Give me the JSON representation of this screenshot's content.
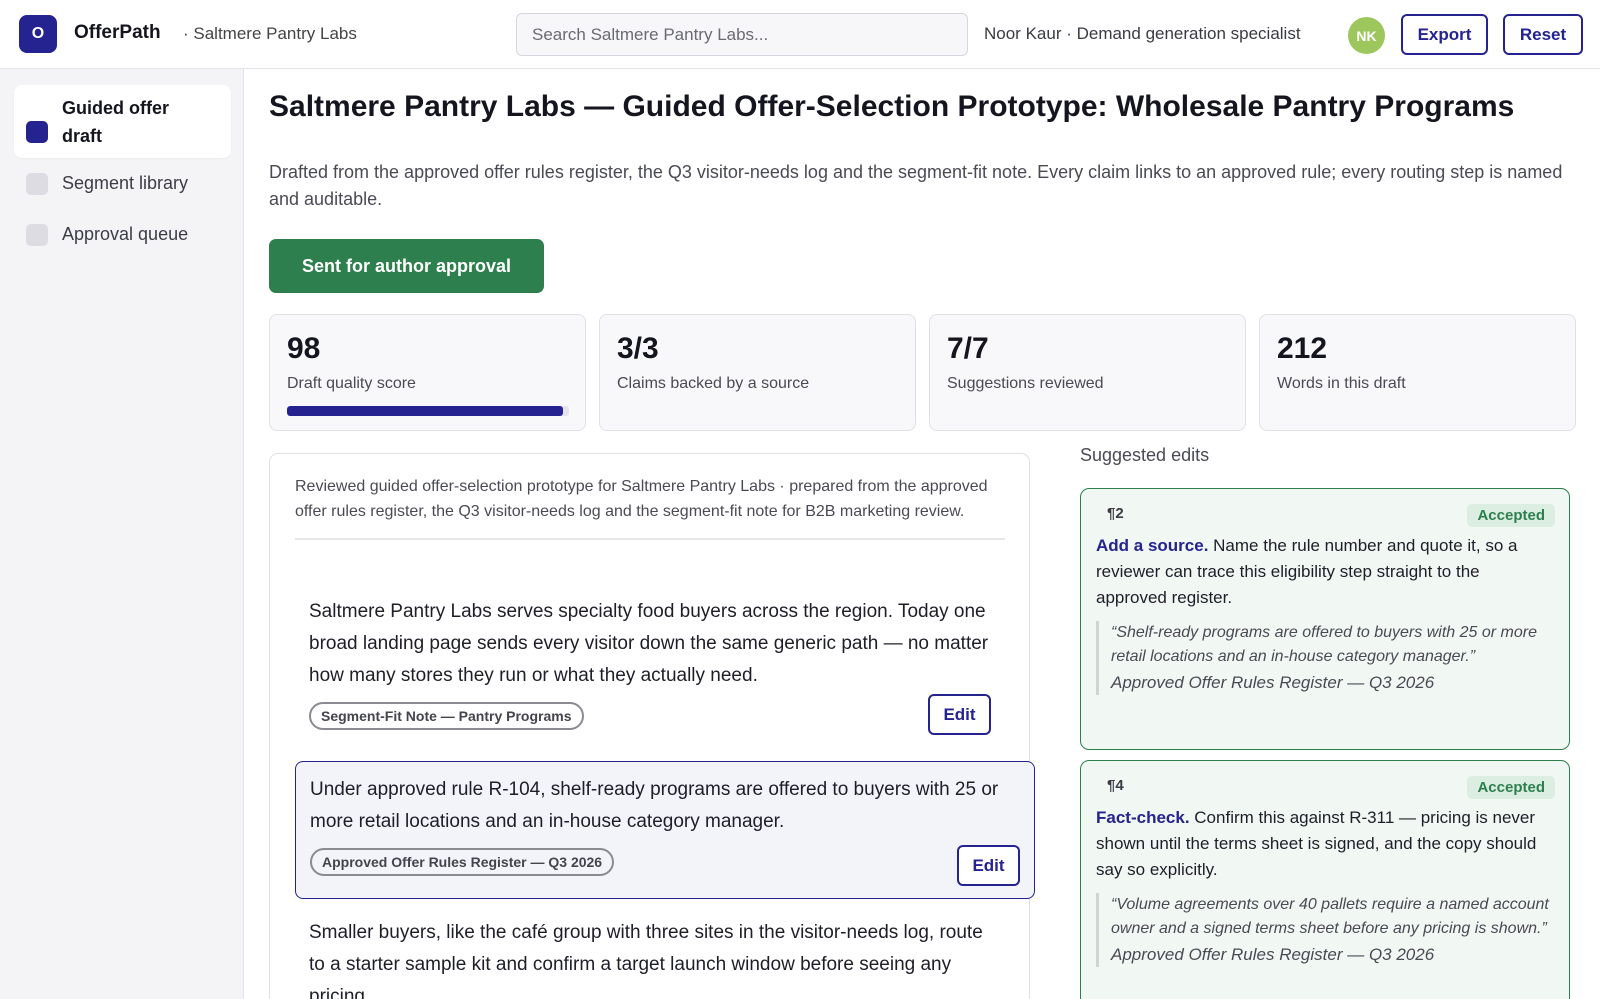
{
  "header": {
    "logo_letter": "O",
    "app_name": "OfferPath",
    "org": "· Saltmere Pantry Labs",
    "search_placeholder": "Search Saltmere Pantry Labs...",
    "user": "Noor Kaur · Demand generation specialist",
    "avatar_initials": "NK",
    "export_label": "Export",
    "reset_label": "Reset"
  },
  "sidebar": {
    "items": [
      {
        "label": "Guided offer draft",
        "active": true
      },
      {
        "label": "Segment library",
        "active": false
      },
      {
        "label": "Approval queue",
        "active": false
      }
    ]
  },
  "main": {
    "title": "Saltmere Pantry Labs — Guided Offer-Selection Prototype: Wholesale Pantry Programs",
    "subtitle": "Drafted from the approved offer rules register, the Q3 visitor-needs log and the segment-fit note. Every claim links to an approved rule; every routing step is named and auditable.",
    "approval_button": "Sent for author approval",
    "stats": [
      {
        "value": "98",
        "label": "Draft quality score",
        "progress": 0.98
      },
      {
        "value": "3/3",
        "label": "Claims backed by a source"
      },
      {
        "value": "7/7",
        "label": "Suggestions reviewed"
      },
      {
        "value": "212",
        "label": "Words in this draft"
      }
    ]
  },
  "draft": {
    "intro": "Reviewed guided offer-selection prototype for Saltmere Pantry Labs · prepared from the approved offer rules register, the Q3 visitor-needs log and the segment-fit note for B2B marketing review.",
    "edit_label": "Edit",
    "paragraphs": [
      {
        "text": "Saltmere Pantry Labs serves specialty food buyers across the region. Today one broad landing page sends every visitor down the same generic path — no matter how many stores they run or what they actually need.",
        "source": "Segment-Fit Note — Pantry Programs"
      },
      {
        "text": "Under approved rule R-104, shelf-ready programs are offered to buyers with 25 or more retail locations and an in-house category manager.",
        "source": "Approved Offer Rules Register — Q3 2026"
      },
      {
        "text": "Smaller buyers, like the café group with three sites in the visitor-needs log, route to a starter sample kit and confirm a target launch window before seeing any pricing."
      }
    ]
  },
  "suggestions": {
    "title": "Suggested edits",
    "items": [
      {
        "para": "¶2",
        "status": "Accepted",
        "kind": "Add a source.",
        "body": "Name the rule number and quote it, so a reviewer can trace this eligibility step straight to the approved register.",
        "quote": "“Shelf-ready programs are offered to buyers with 25 or more retail locations and an in-house category manager.”",
        "source": "Approved Offer Rules Register — Q3 2026"
      },
      {
        "para": "¶4",
        "status": "Accepted",
        "kind": "Fact-check.",
        "body": "Confirm this against R-311 — pricing is never shown until the terms sheet is signed, and the copy should say so explicitly.",
        "quote": "“Volume agreements over 40 pallets require a named account owner and a signed terms sheet before any pricing is shown.”",
        "source": "Approved Offer Rules Register — Q3 2026"
      }
    ]
  }
}
